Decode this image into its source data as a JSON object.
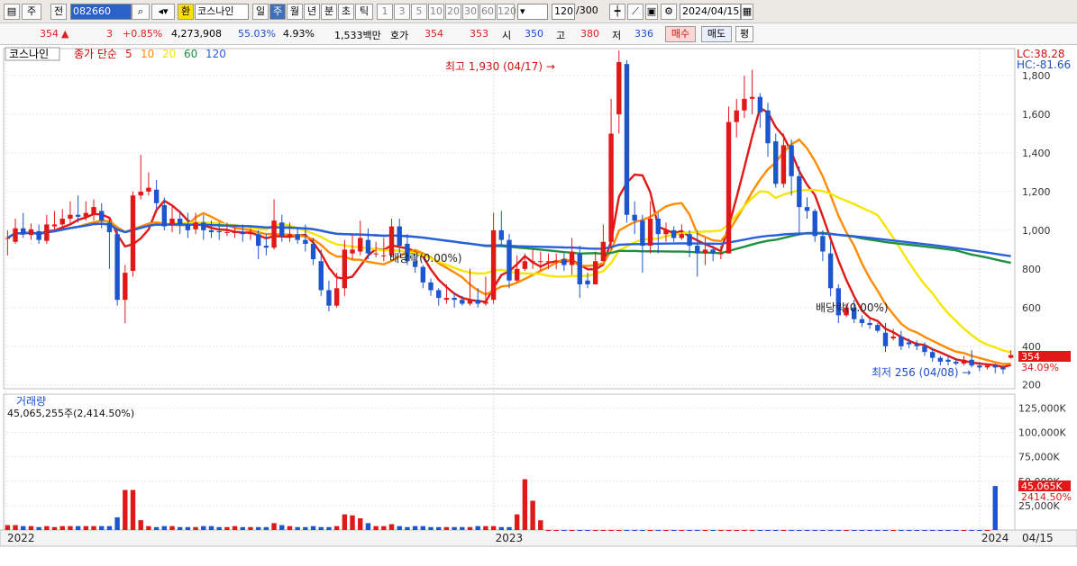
{
  "toolbar": {
    "kind": "주",
    "prev": "전",
    "code": "082660",
    "han_badge": "환",
    "name": "코스나인",
    "periods": [
      "일",
      "주",
      "월",
      "년",
      "분",
      "초",
      "틱"
    ],
    "active_period": 1,
    "intervals": [
      "1",
      "3",
      "5",
      "10",
      "20",
      "30",
      "60",
      "120"
    ],
    "count": "120",
    "count_total": "/300",
    "date": "2024/04/15"
  },
  "quote": {
    "price": "354",
    "arrow": "▲",
    "change": "3",
    "change_pct": "+0.85%",
    "volume": "4,273,908",
    "ratio": "55.03%",
    "turnover": "4.93%",
    "amount": "1,533백만",
    "hoga_label": "호가",
    "bid": "354",
    "ask": "353",
    "open_label": "시",
    "open": "350",
    "high_label": "고",
    "high": "380",
    "low_label": "저",
    "low": "336",
    "buy_label": "매수",
    "sell_label": "매도",
    "avg_label": "평"
  },
  "chart_data": {
    "type": "candlestick",
    "title_tag": "코스나인",
    "legend_prefix": "종가 단순",
    "ma_periods": [
      "5",
      "10",
      "20",
      "60",
      "120"
    ],
    "ma_colors": [
      "#e01818",
      "#ff8c00",
      "#f5e600",
      "#1f9040",
      "#2a5fe0"
    ],
    "up_color": "#e01818",
    "down_color": "#1c55cc",
    "price_ylim": [
      180,
      1940
    ],
    "price_ticks": [
      200,
      400,
      600,
      800,
      1000,
      1200,
      1400,
      1600,
      1800
    ],
    "lc": "LC:38.28",
    "hc": "HC:-81.66",
    "high_marker": "최고 1,930 (04/17)",
    "low_marker": "최저 256 (04/08)",
    "dividend_labels": [
      "배당락(0.00%)",
      "배당락(0.00%)"
    ],
    "last_price_tag": "354",
    "last_pct_tag": "34.09%",
    "x_labels": [
      "2022",
      "2023",
      "2024"
    ],
    "last_date": "04/15",
    "volume_title": "거래량",
    "volume_info": "45,065,255주(2,414.50%)",
    "volume_ticks": [
      "125,000K",
      "100,000K",
      "75,000K",
      "50,000K",
      "25,000K"
    ],
    "volume_ylim": [
      0,
      130000
    ],
    "last_volume_tag": "45,065K",
    "last_volume_pct_tag": "2414.50%",
    "candles": [
      [
        960,
        960,
        1000,
        870
      ],
      [
        940,
        1010,
        1060,
        930
      ],
      [
        1010,
        980,
        1090,
        960
      ],
      [
        975,
        1005,
        1035,
        950
      ],
      [
        995,
        950,
        1030,
        930
      ],
      [
        945,
        1030,
        1080,
        930
      ],
      [
        1020,
        1030,
        1100,
        1000
      ],
      [
        1030,
        1060,
        1110,
        1010
      ],
      [
        1060,
        1080,
        1150,
        1030
      ],
      [
        1080,
        1070,
        1180,
        1040
      ],
      [
        1070,
        1090,
        1150,
        1050
      ],
      [
        1080,
        1120,
        1160,
        1050
      ],
      [
        1100,
        1050,
        1140,
        1010
      ],
      [
        1040,
        990,
        1060,
        800
      ],
      [
        980,
        640,
        1000,
        610
      ],
      [
        640,
        780,
        820,
        520
      ],
      [
        790,
        1180,
        1200,
        760
      ],
      [
        1180,
        1200,
        1390,
        1160
      ],
      [
        1200,
        1220,
        1300,
        1180
      ],
      [
        1210,
        1140,
        1260,
        1110
      ],
      [
        1130,
        1020,
        1170,
        1000
      ],
      [
        1030,
        1060,
        1120,
        990
      ],
      [
        1060,
        1030,
        1100,
        980
      ],
      [
        1030,
        1000,
        1090,
        960
      ],
      [
        1005,
        1040,
        1090,
        980
      ],
      [
        1040,
        1000,
        1080,
        950
      ],
      [
        1000,
        990,
        1050,
        960
      ],
      [
        995,
        990,
        1040,
        950
      ],
      [
        990,
        990,
        1040,
        970
      ],
      [
        985,
        990,
        1020,
        960
      ],
      [
        990,
        980,
        1030,
        940
      ],
      [
        980,
        990,
        1010,
        950
      ],
      [
        980,
        920,
        1000,
        850
      ],
      [
        920,
        910,
        980,
        870
      ],
      [
        910,
        1050,
        1160,
        900
      ],
      [
        1040,
        970,
        1080,
        940
      ],
      [
        970,
        980,
        1040,
        940
      ],
      [
        980,
        950,
        1010,
        930
      ],
      [
        950,
        930,
        1030,
        890
      ],
      [
        930,
        850,
        960,
        820
      ],
      [
        840,
        690,
        900,
        660
      ],
      [
        690,
        610,
        740,
        580
      ],
      [
        610,
        700,
        780,
        600
      ],
      [
        700,
        900,
        950,
        660
      ],
      [
        880,
        900,
        980,
        850
      ],
      [
        890,
        960,
        1050,
        870
      ],
      [
        950,
        880,
        1010,
        850
      ],
      [
        880,
        880,
        940,
        860
      ],
      [
        870,
        870,
        960,
        840
      ],
      [
        870,
        1020,
        1060,
        860
      ],
      [
        1020,
        920,
        1060,
        880
      ],
      [
        930,
        840,
        980,
        820
      ],
      [
        840,
        810,
        880,
        780
      ],
      [
        810,
        730,
        820,
        700
      ],
      [
        730,
        690,
        750,
        660
      ],
      [
        690,
        650,
        700,
        610
      ],
      [
        640,
        650,
        720,
        620
      ],
      [
        650,
        640,
        680,
        600
      ],
      [
        640,
        620,
        660,
        610
      ],
      [
        620,
        640,
        800,
        610
      ],
      [
        640,
        620,
        700,
        600
      ],
      [
        620,
        630,
        760,
        610
      ],
      [
        640,
        1000,
        1090,
        620
      ],
      [
        1000,
        950,
        1100,
        920
      ],
      [
        950,
        740,
        980,
        700
      ],
      [
        740,
        800,
        870,
        730
      ],
      [
        800,
        840,
        880,
        790
      ],
      [
        840,
        840,
        900,
        800
      ],
      [
        840,
        840,
        890,
        790
      ],
      [
        840,
        840,
        880,
        800
      ],
      [
        840,
        840,
        880,
        800
      ],
      [
        850,
        820,
        880,
        790
      ],
      [
        820,
        890,
        960,
        770
      ],
      [
        880,
        720,
        920,
        650
      ],
      [
        740,
        720,
        780,
        700
      ],
      [
        720,
        840,
        890,
        730
      ],
      [
        840,
        940,
        1030,
        840
      ],
      [
        940,
        1500,
        1680,
        900
      ],
      [
        1600,
        1870,
        1930,
        1500
      ],
      [
        1860,
        1080,
        1880,
        1040
      ],
      [
        1080,
        1050,
        1150,
        980
      ],
      [
        1050,
        920,
        1080,
        780
      ],
      [
        920,
        1060,
        1150,
        880
      ],
      [
        1060,
        980,
        1090,
        880
      ],
      [
        980,
        1000,
        1040,
        940
      ],
      [
        1000,
        960,
        1020,
        940
      ],
      [
        960,
        980,
        1030,
        950
      ],
      [
        980,
        920,
        1000,
        860
      ],
      [
        920,
        880,
        1000,
        760
      ],
      [
        880,
        900,
        960,
        820
      ],
      [
        900,
        880,
        920,
        840
      ],
      [
        880,
        880,
        920,
        850
      ],
      [
        880,
        1560,
        1640,
        880
      ],
      [
        1560,
        1620,
        1680,
        1480
      ],
      [
        1620,
        1680,
        1800,
        1580
      ],
      [
        1680,
        1690,
        1830,
        1600
      ],
      [
        1690,
        1610,
        1710,
        1530
      ],
      [
        1620,
        1450,
        1660,
        1380
      ],
      [
        1460,
        1240,
        1500,
        1220
      ],
      [
        1240,
        1440,
        1500,
        1220
      ],
      [
        1440,
        1280,
        1470,
        1180
      ],
      [
        1280,
        1120,
        1330,
        980
      ],
      [
        1120,
        1100,
        1170,
        1060
      ],
      [
        1100,
        970,
        1110,
        940
      ],
      [
        970,
        890,
        1000,
        840
      ],
      [
        880,
        700,
        940,
        660
      ],
      [
        700,
        560,
        720,
        520
      ],
      [
        560,
        600,
        620,
        550
      ],
      [
        600,
        540,
        640,
        520
      ],
      [
        540,
        520,
        560,
        500
      ],
      [
        520,
        510,
        540,
        490
      ],
      [
        510,
        480,
        520,
        470
      ],
      [
        470,
        400,
        520,
        370
      ],
      [
        440,
        450,
        490,
        430
      ],
      [
        450,
        400,
        480,
        380
      ],
      [
        420,
        410,
        440,
        390
      ],
      [
        410,
        400,
        430,
        380
      ],
      [
        400,
        370,
        420,
        350
      ],
      [
        370,
        340,
        390,
        320
      ],
      [
        340,
        320,
        350,
        300
      ],
      [
        330,
        320,
        350,
        300
      ],
      [
        320,
        310,
        330,
        300
      ],
      [
        310,
        330,
        350,
        300
      ],
      [
        330,
        300,
        380,
        290
      ],
      [
        300,
        290,
        320,
        270
      ],
      [
        290,
        300,
        310,
        280
      ],
      [
        300,
        290,
        310,
        260
      ],
      [
        290,
        280,
        300,
        256
      ],
      [
        340,
        354,
        380,
        336
      ]
    ],
    "volumes": [
      5000,
      5000,
      4000,
      4000,
      3000,
      4000,
      3000,
      4000,
      4000,
      4000,
      4000,
      4000,
      4000,
      4000,
      13000,
      41000,
      41000,
      10000,
      4000,
      3000,
      4000,
      4000,
      3000,
      3000,
      3000,
      4000,
      4000,
      3000,
      3000,
      4000,
      3000,
      3000,
      3000,
      3000,
      7000,
      5000,
      4000,
      3000,
      3000,
      4000,
      3000,
      3000,
      4000,
      16000,
      15000,
      12000,
      7000,
      4000,
      4000,
      6000,
      4000,
      3000,
      4000,
      4000,
      3000,
      3000,
      3000,
      3000,
      3000,
      3000,
      4000,
      4000,
      4000,
      3000,
      3000,
      16000,
      52000,
      30000,
      10000,
      0,
      0,
      0,
      0,
      0,
      0,
      0,
      0,
      0,
      0,
      0,
      0,
      0,
      0,
      0,
      0,
      0,
      0,
      0,
      0,
      0,
      0,
      0,
      0,
      0,
      0,
      0,
      0,
      0,
      0,
      0,
      0,
      0,
      0,
      0,
      0,
      0,
      0,
      0,
      0,
      0,
      0,
      0,
      0,
      0,
      0,
      0,
      0,
      0,
      0,
      0,
      0,
      0,
      0,
      0,
      0,
      0,
      45065
    ]
  }
}
